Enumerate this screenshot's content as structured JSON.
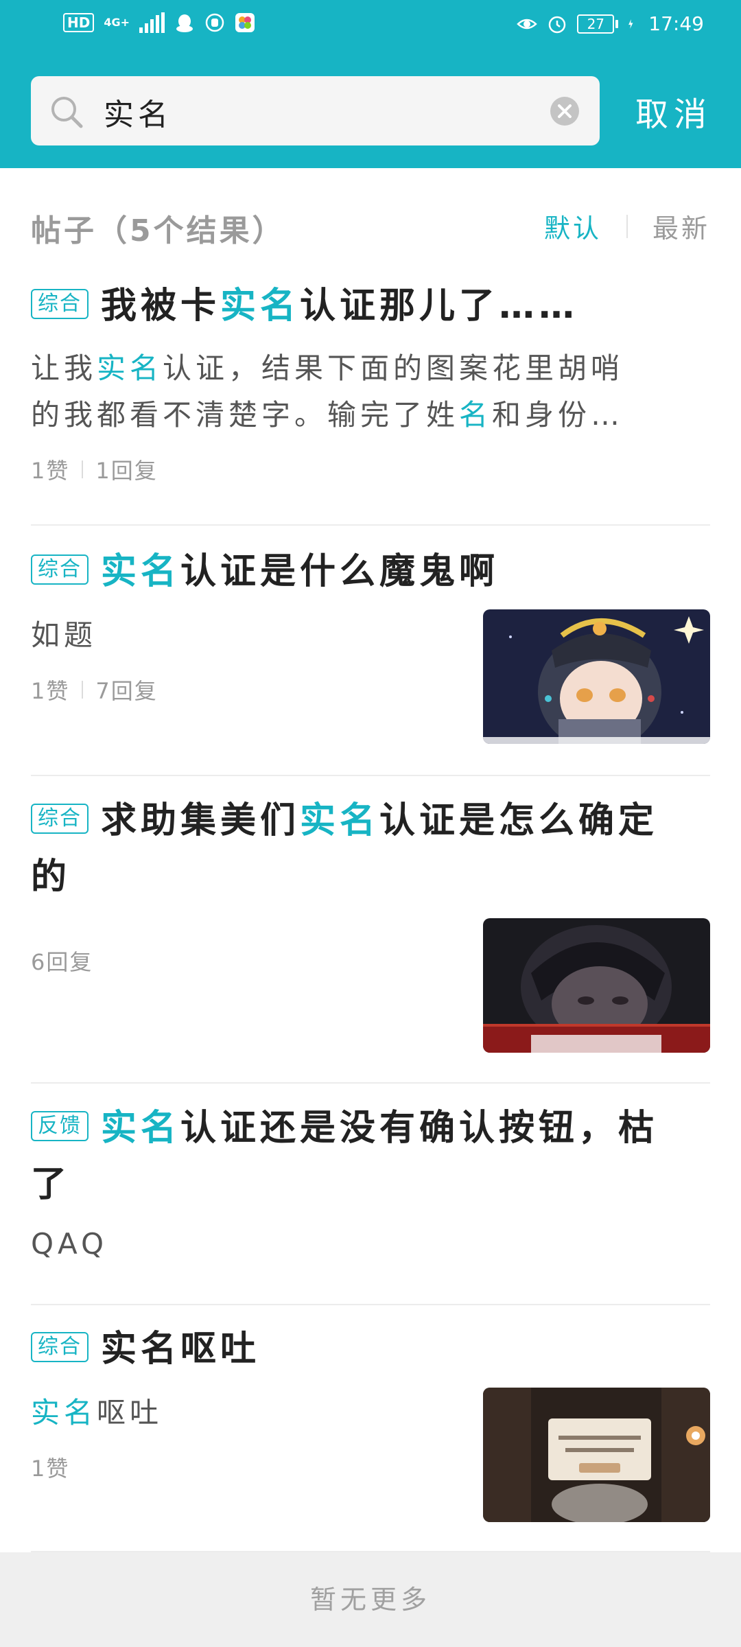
{
  "status_bar": {
    "hd_label": "HD",
    "network_label": "4G+",
    "battery_level": "27",
    "time": "17:49"
  },
  "search": {
    "query": "实名",
    "cancel_label": "取消"
  },
  "results": {
    "title": "帖子（5个结果）",
    "sort_default": "默认",
    "sort_newest": "最新"
  },
  "posts": [
    {
      "tag": "综合",
      "title_parts": [
        "我被卡",
        "实",
        "名",
        "认证那儿了……"
      ],
      "excerpt_line1_parts": [
        "让我",
        "实",
        "名",
        "认证，结果下面的图案花里胡哨"
      ],
      "excerpt_line2_parts": [
        "的我都看不清楚字。输完了姓",
        "名",
        "和身份…"
      ],
      "likes": "1赞",
      "replies": "1回复"
    },
    {
      "tag": "综合",
      "title_parts": [
        "实",
        "名",
        "认证是什么魔鬼啊"
      ],
      "excerpt": "如题",
      "likes": "1赞",
      "replies": "7回复"
    },
    {
      "tag": "综合",
      "title_line1_parts": [
        "求助集美们",
        "实",
        "名",
        "认证是怎么确定"
      ],
      "title_line2": "的",
      "replies": "6回复"
    },
    {
      "tag": "反馈",
      "title_line1_parts": [
        "实",
        "名",
        "认证还是没有确认按钮，枯"
      ],
      "title_line2": "了",
      "excerpt": "QAQ"
    },
    {
      "tag": "综合",
      "title": "实名呕吐",
      "excerpt_parts": [
        "实",
        "名",
        "呕吐"
      ],
      "likes": "1赞"
    }
  ],
  "footer": {
    "text": "暂无更多"
  },
  "colors": {
    "accent": "#17b4c4",
    "header": "#17b4c4",
    "footer_bg": "#efefef"
  }
}
